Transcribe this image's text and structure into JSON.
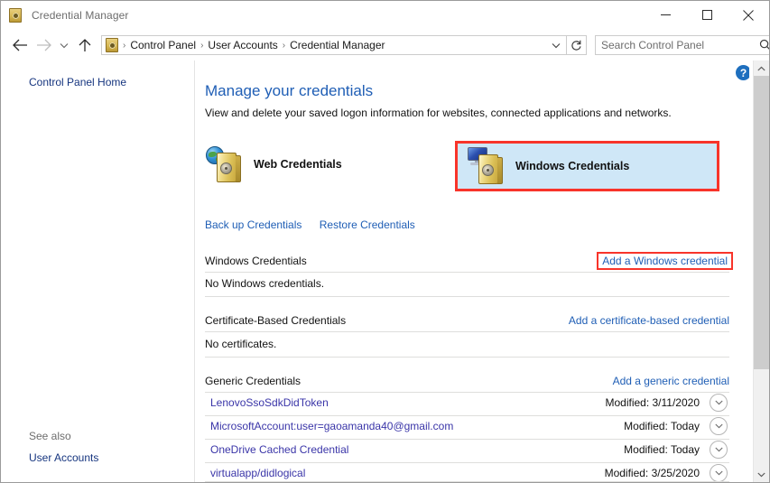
{
  "window": {
    "title": "Credential Manager",
    "title_icon": "credential-safe-icon",
    "minimize_label": "Minimize",
    "maximize_label": "Maximize",
    "close_label": "Close"
  },
  "nav": {
    "back_label": "Back",
    "forward_label": "Forward",
    "recent_label": "Recent locations",
    "up_label": "Up one level",
    "refresh_label": "Refresh",
    "breadcrumbs": [
      "Control Panel",
      "User Accounts",
      "Credential Manager"
    ],
    "separator": "›"
  },
  "search": {
    "placeholder": "Search Control Panel",
    "value": "",
    "icon": "search-icon"
  },
  "sidebar": {
    "control_panel_home": "Control Panel Home",
    "see_also_label": "See also",
    "user_accounts": "User Accounts"
  },
  "main": {
    "help_label": "?",
    "page_title": "Manage your credentials",
    "page_subtitle": "View and delete your saved logon information for websites, connected applications and networks.",
    "tiles": [
      {
        "label": "Web Credentials",
        "icon": "globe-vault-icon",
        "selected": false
      },
      {
        "label": "Windows Credentials",
        "icon": "monitor-vault-icon",
        "selected": true
      }
    ],
    "links": [
      {
        "label": "Back up Credentials"
      },
      {
        "label": "Restore Credentials"
      }
    ],
    "sections": [
      {
        "title": "Windows Credentials",
        "action": "Add a Windows credential",
        "action_highlighted": true,
        "empty_note": "No Windows credentials.",
        "rows": []
      },
      {
        "title": "Certificate-Based Credentials",
        "action": "Add a certificate-based credential",
        "action_highlighted": false,
        "empty_note": "No certificates.",
        "rows": []
      },
      {
        "title": "Generic Credentials",
        "action": "Add a generic credential",
        "action_highlighted": false,
        "empty_note": "",
        "rows": [
          {
            "name": "LenovoSsoSdkDidToken",
            "modified": "Modified:  3/11/2020"
          },
          {
            "name": "MicrosoftAccount:user=gaoamanda40@gmail.com",
            "modified": "Modified:  Today"
          },
          {
            "name": "OneDrive Cached Credential",
            "modified": "Modified:  Today"
          },
          {
            "name": "virtualapp/didlogical",
            "modified": "Modified:  3/25/2020"
          }
        ]
      }
    ]
  },
  "colors": {
    "highlight_red": "#f8342a",
    "selection_blue": "#cfe7f7",
    "link_blue": "#1f5eb5",
    "credential_link": "#3a35a8",
    "title_blue": "#1f5eb5"
  },
  "scrollbar": {
    "up_label": "Scroll up",
    "down_label": "Scroll down",
    "thumb_label": "Vertical scrollbar thumb"
  }
}
